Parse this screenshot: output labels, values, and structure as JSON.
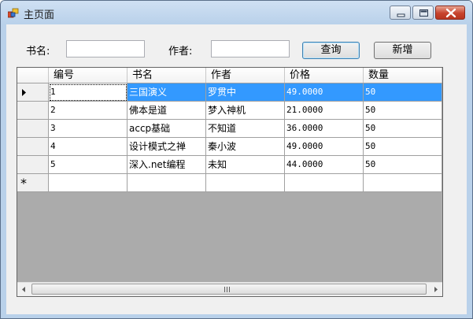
{
  "window": {
    "title": "主页面"
  },
  "search": {
    "book_label": "书名:",
    "book_value": "",
    "author_label": "作者:",
    "author_value": ""
  },
  "buttons": {
    "query": "查询",
    "add": "新增"
  },
  "grid": {
    "columns": [
      "编号",
      "书名",
      "作者",
      "价格",
      "数量"
    ],
    "rows": [
      [
        "1",
        "三国演义",
        "罗贯中",
        "49.0000",
        "50"
      ],
      [
        "2",
        "佛本是道",
        "梦入神机",
        "21.0000",
        "50"
      ],
      [
        "3",
        "accp基础",
        "不知道",
        "36.0000",
        "50"
      ],
      [
        "4",
        "设计模式之禅",
        "秦小波",
        "49.0000",
        "50"
      ],
      [
        "5",
        "深入.net编程",
        "未知",
        "44.0000",
        "50"
      ]
    ],
    "new_row_marker": "*"
  },
  "colors": {
    "selection": "#3399ff",
    "window_frame": "#b9d1ea",
    "grid_background": "#ababab",
    "close_button": "#c7432d"
  }
}
